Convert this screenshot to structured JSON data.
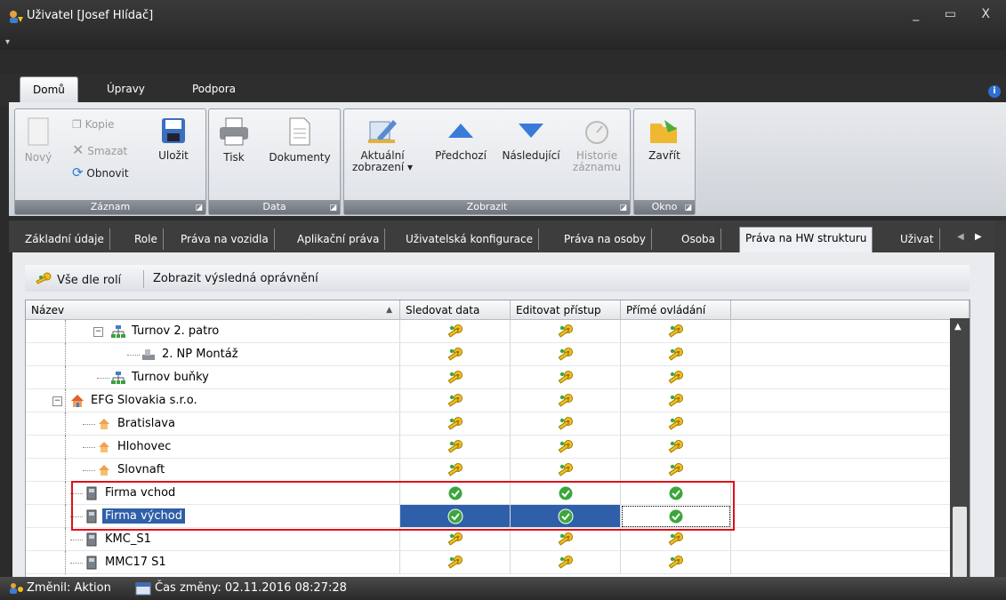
{
  "window": {
    "title": "Uživatel [Josef Hlídač]",
    "controls": [
      "_",
      "▭",
      "X"
    ]
  },
  "ribbon_tabs": [
    "Domů",
    "Úpravy",
    "Podpora"
  ],
  "ribbon": {
    "zaznam": {
      "label": "Záznam",
      "novy": "Nový",
      "kopie": "Kopie",
      "smazat": "Smazat",
      "obnovit": "Obnovit",
      "ulozit": "Uložit"
    },
    "data": {
      "label": "Data",
      "tisk": "Tisk",
      "dokumenty": "Dokumenty"
    },
    "zobrazit": {
      "label": "Zobrazit",
      "aktualni_1": "Aktuální",
      "aktualni_2": "zobrazení ▾",
      "predchozi": "Předchozí",
      "nasledujici": "Následující",
      "historie_1": "Historie",
      "historie_2": "záznamu"
    },
    "okno": {
      "label": "Okno",
      "zavrit": "Zavřít"
    }
  },
  "page_tabs": [
    "Základní údaje",
    "Role",
    "Práva na vozidla",
    "Aplikační práva",
    "Uživatelská konfigurace",
    "Práva na osoby",
    "Osoba",
    "Práva na HW strukturu",
    "Uživat"
  ],
  "toolbar": {
    "vse_dle_roli": "Vše dle rolí",
    "zobrazit_vysledna": "Zobrazit výsledná oprávnění"
  },
  "grid": {
    "columns": [
      "Název",
      "Sledovat data",
      "Editovat přístup",
      "Přímé ovládání"
    ],
    "rows": [
      {
        "name": "Turnov 2. patro",
        "perm": [
          "key",
          "key",
          "key"
        ]
      },
      {
        "name": "2. NP Montáž",
        "perm": [
          "key",
          "key",
          "key"
        ]
      },
      {
        "name": "Turnov buňky",
        "perm": [
          "key",
          "key",
          "key"
        ]
      },
      {
        "name": "EFG Slovakia s.r.o.",
        "perm": [
          "key",
          "key",
          "key"
        ]
      },
      {
        "name": "Bratislava",
        "perm": [
          "key",
          "key",
          "key"
        ]
      },
      {
        "name": "Hlohovec",
        "perm": [
          "key",
          "key",
          "key"
        ]
      },
      {
        "name": "Slovnaft",
        "perm": [
          "key",
          "key",
          "key"
        ]
      },
      {
        "name": "Firma vchod",
        "perm": [
          "check",
          "check",
          "check"
        ]
      },
      {
        "name": "Firma východ",
        "perm": [
          "check",
          "check",
          "check"
        ]
      },
      {
        "name": "KMC_S1",
        "perm": [
          "key",
          "key",
          "key"
        ]
      },
      {
        "name": "MMC17 S1",
        "perm": [
          "key",
          "key",
          "key"
        ]
      }
    ]
  },
  "status": {
    "zmenil": "Změnil: Aktion",
    "cas_zmeny": "Čas změny: 02.11.2016 08:27:28"
  },
  "colors": {
    "selection": "#2f5fa8",
    "highlight_box": "#e0101a",
    "check_green": "#3ca63c",
    "key_yellow": "#f0c020"
  }
}
